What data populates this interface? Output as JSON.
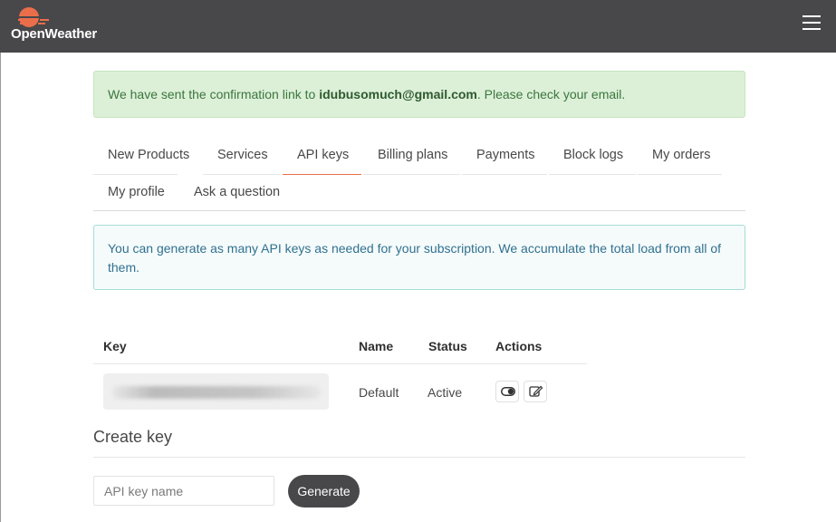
{
  "header": {
    "brand": "OpenWeather",
    "logo_icon": "sun-logo-icon",
    "menu_icon": "hamburger-menu-icon",
    "colors": {
      "bar": "#48484a",
      "sun": "#eb6e4b"
    }
  },
  "alerts": {
    "success": {
      "prefix": "We have sent the confirmation link to ",
      "email": "idubusomuch@gmail.com",
      "suffix": ". Please check your email."
    },
    "info": "You can generate as many API keys as needed for your subscription. We accumulate the total load from all of them."
  },
  "tabs": [
    {
      "label": "New Products",
      "active": false
    },
    {
      "label": "Services",
      "active": false
    },
    {
      "label": "API keys",
      "active": true
    },
    {
      "label": "Billing plans",
      "active": false
    },
    {
      "label": "Payments",
      "active": false
    },
    {
      "label": "Block logs",
      "active": false
    },
    {
      "label": "My orders",
      "active": false
    },
    {
      "label": "My profile",
      "active": false
    },
    {
      "label": "Ask a question",
      "active": false
    }
  ],
  "keys_table": {
    "columns": [
      "Key",
      "Name",
      "Status",
      "Actions"
    ],
    "rows": [
      {
        "key": "",
        "name": "Default",
        "status": "Active",
        "actions": [
          "toggle-icon",
          "edit-icon"
        ]
      }
    ]
  },
  "create_key": {
    "title": "Create key",
    "input_placeholder": "API key name",
    "input_value": "",
    "button_label": "Generate"
  },
  "accent_color": "#eb6e4b"
}
